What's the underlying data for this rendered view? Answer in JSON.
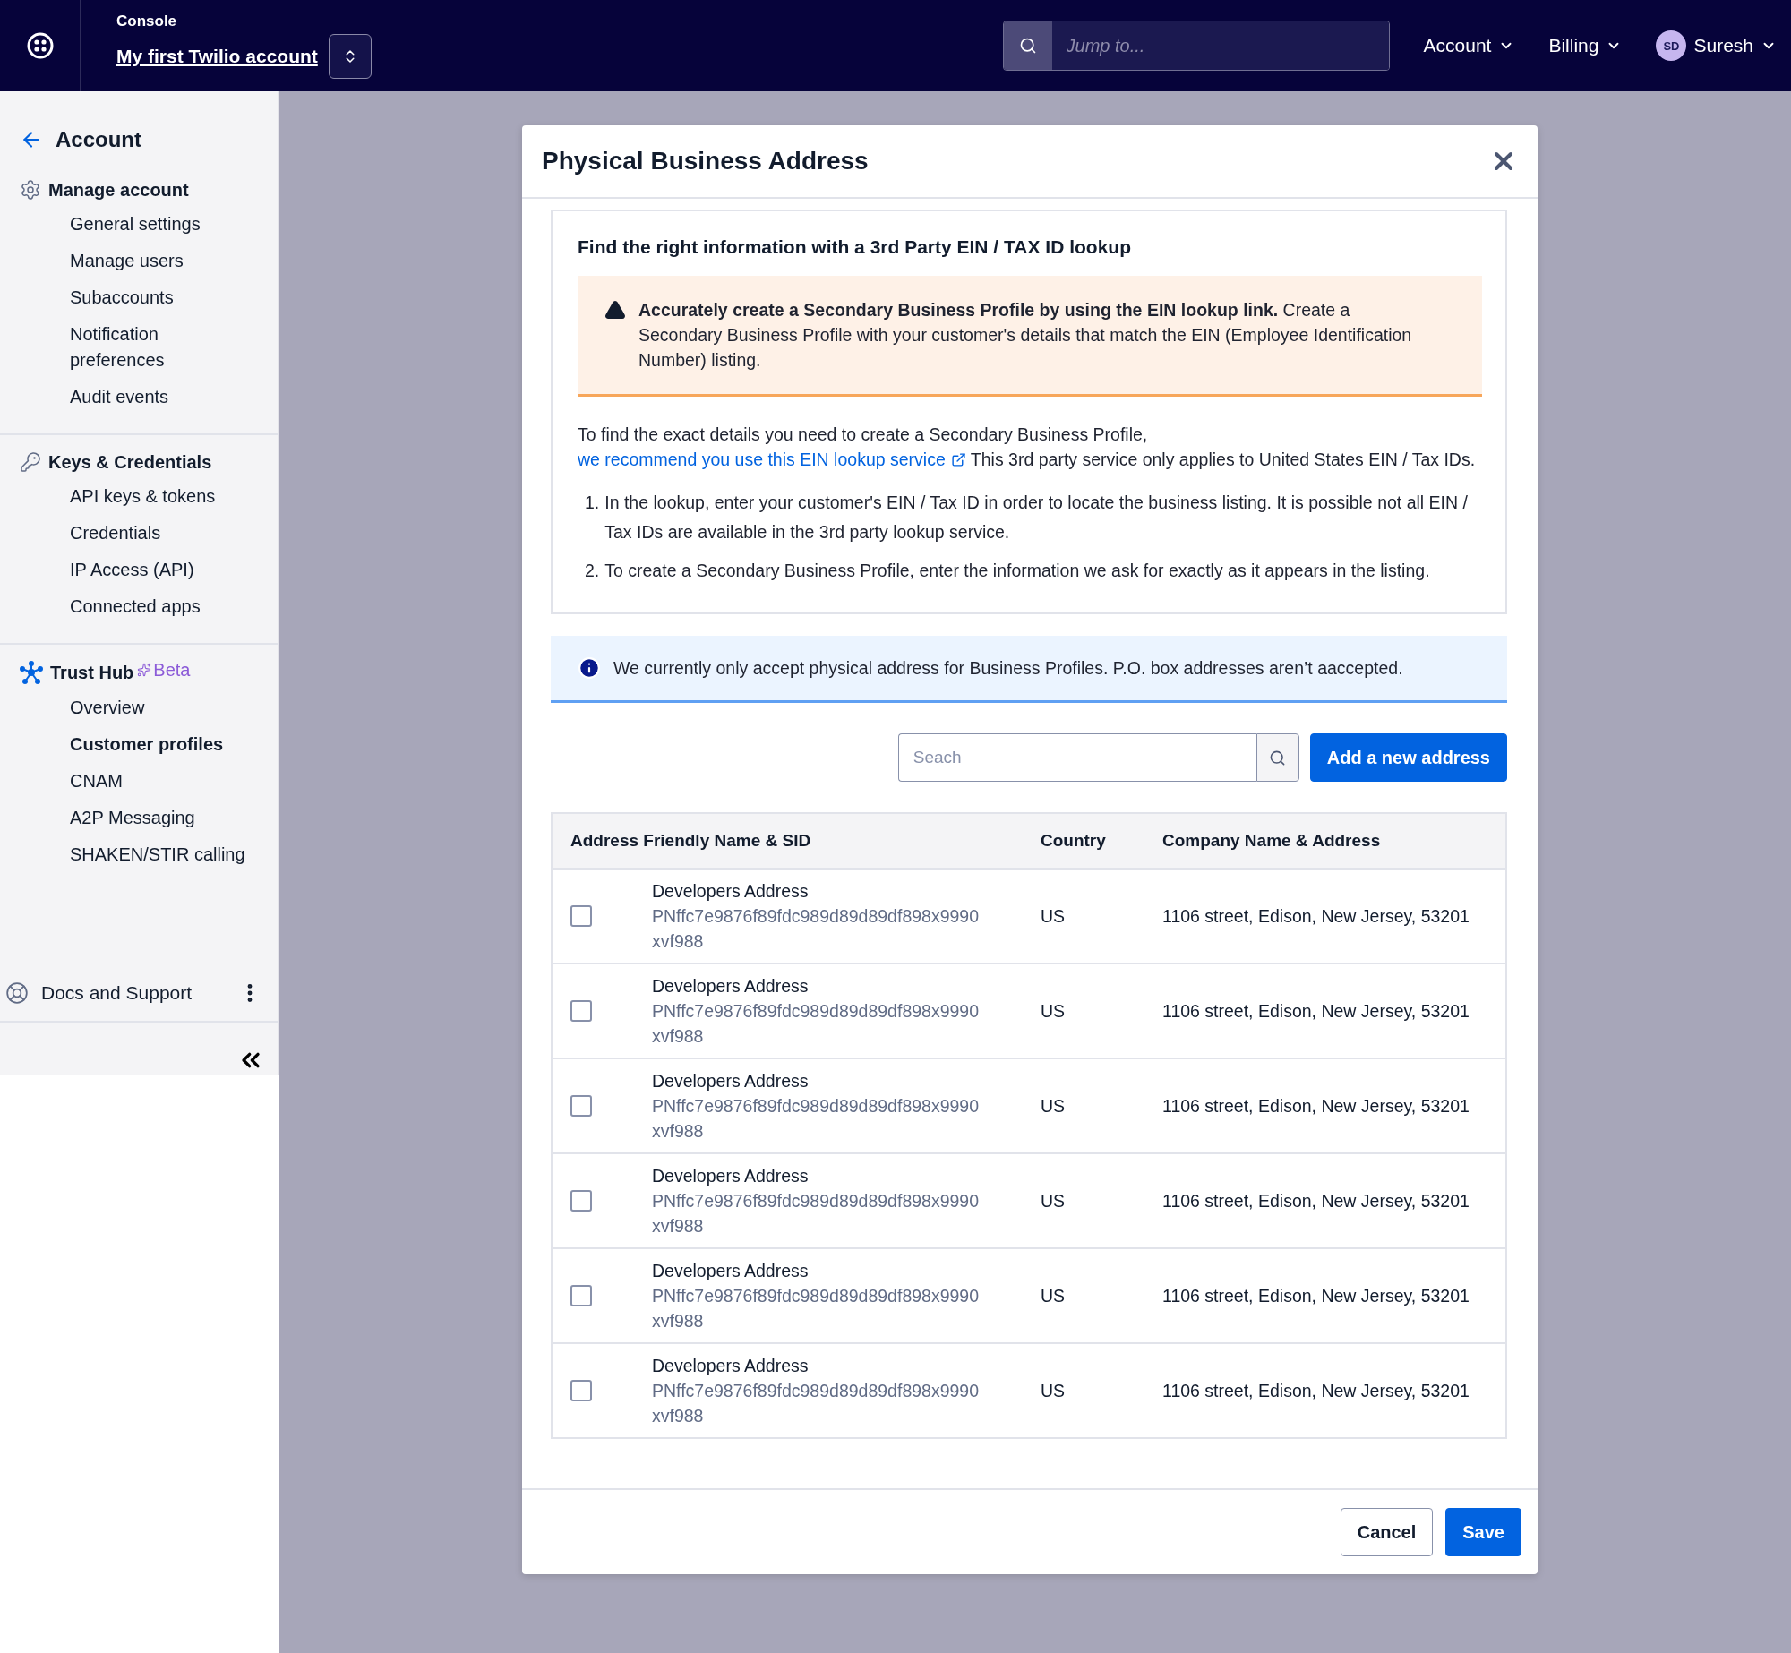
{
  "topbar": {
    "console_label": "Console",
    "account_name": "My first Twilio account",
    "search": {
      "placeholder": "Jump to..."
    },
    "menus": [
      {
        "label": "Account"
      },
      {
        "label": "Billing"
      }
    ],
    "user": {
      "initials": "SD",
      "name": "Suresh"
    }
  },
  "sidebar": {
    "back_label": "Account",
    "sections": [
      {
        "kind": "gear",
        "title": "Manage account",
        "items": [
          {
            "label": "General settings",
            "selected": false
          },
          {
            "label": "Manage users",
            "selected": false
          },
          {
            "label": "Subaccounts",
            "selected": false
          },
          {
            "label": "Notification preferences",
            "selected": false
          },
          {
            "label": "Audit events",
            "selected": false
          }
        ]
      },
      {
        "kind": "key",
        "title": "Keys & Credentials",
        "items": [
          {
            "label": "API keys & tokens",
            "selected": false
          },
          {
            "label": "Credentials",
            "selected": false
          },
          {
            "label": "IP Access (API)",
            "selected": false
          },
          {
            "label": "Connected apps",
            "selected": false
          }
        ]
      },
      {
        "kind": "hub",
        "title": "Trust Hub",
        "badge": "Beta",
        "items": [
          {
            "label": "Overview",
            "selected": false
          },
          {
            "label": "Customer profiles",
            "selected": true
          },
          {
            "label": "CNAM",
            "selected": false
          },
          {
            "label": "A2P Messaging",
            "selected": false
          },
          {
            "label": "SHAKEN/STIR calling",
            "selected": false
          }
        ]
      }
    ],
    "footer": {
      "label": "Docs and Support"
    }
  },
  "dialog": {
    "title": "Physical Business Address",
    "lookup": {
      "heading": "Find the right information with a 3rd Party EIN / TAX ID lookup",
      "warning": "**Accurately create a Secondary Business Profile by using the EIN lookup link.** Create a Secondary Business Profile with your customer's details that match the EIN (Employee Identification Number) listing.",
      "intro": "To find the exact details you need to create a Secondary Business Profile,",
      "link": "we recommend you use this EIN lookup service",
      "after": "This 3rd party service only applies to United States EIN / Tax IDs.",
      "steps": [
        {
          "number": "1.",
          "text": "In the lookup, enter your customer's EIN / Tax ID in order to locate the business listing. It is possible not all EIN / Tax IDs are available in the 3rd party lookup service."
        },
        {
          "number": "2.",
          "text": "To create a Secondary Business Profile, enter the information we ask for exactly as it appears in the listing."
        }
      ]
    },
    "notice": "We currently only accept physical address for Business Profiles. P.O. box addresses aren’t aaccepted.",
    "search": {
      "placeholder": "Seach"
    },
    "add_button": "Add a new address",
    "table": {
      "columns": [
        "Address Friendly Name & SID",
        "Country",
        "Company Name & Address"
      ],
      "rows": [
        {
          "checked": false,
          "name": "Developers Address",
          "sid": "PNffc7e9876f89fdc989d89d89df898x9990xvf988",
          "country": "US",
          "address": "1106 street, Edison, New Jersey, 53201"
        },
        {
          "checked": false,
          "name": "Developers Address",
          "sid": "PNffc7e9876f89fdc989d89d89df898x9990xvf988",
          "country": "US",
          "address": "1106 street, Edison, New Jersey, 53201"
        },
        {
          "checked": false,
          "name": "Developers Address",
          "sid": "PNffc7e9876f89fdc989d89d89df898x9990xvf988",
          "country": "US",
          "address": "1106 street, Edison, New Jersey, 53201"
        },
        {
          "checked": false,
          "name": "Developers Address",
          "sid": "PNffc7e9876f89fdc989d89d89df898x9990xvf988",
          "country": "US",
          "address": "1106 street, Edison, New Jersey, 53201"
        },
        {
          "checked": false,
          "name": "Developers Address",
          "sid": "PNffc7e9876f89fdc989d89d89df898x9990xvf988",
          "country": "US",
          "address": "1106 street, Edison, New Jersey, 53201"
        },
        {
          "checked": false,
          "name": "Developers Address",
          "sid": "PNffc7e9876f89fdc989d89d89df898x9990xvf988",
          "country": "US",
          "address": "1106 street, Edison, New Jersey, 53201"
        }
      ]
    },
    "buttons": [
      {
        "label": "Cancel",
        "kind": "secondary"
      },
      {
        "label": "Save",
        "kind": "primary"
      }
    ]
  }
}
